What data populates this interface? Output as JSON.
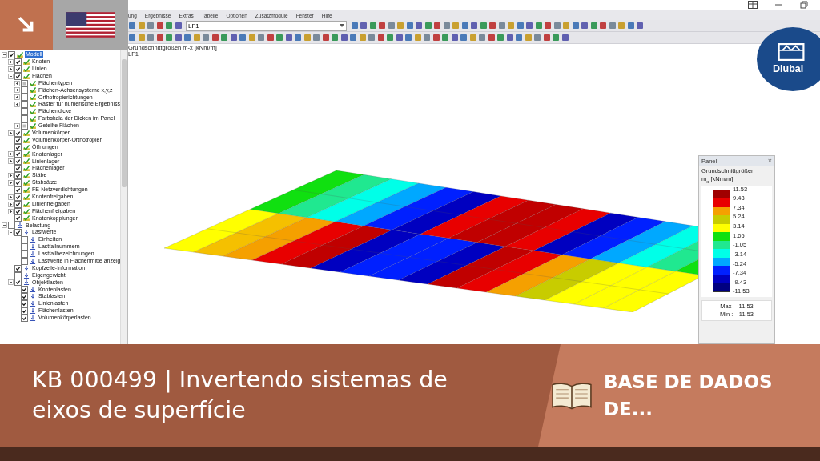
{
  "menu": [
    "ung",
    "Ergebnisse",
    "Extras",
    "Tabelle",
    "Optionen",
    "Zusatzmodule",
    "Fenster",
    "Hilfe"
  ],
  "toolbar": {
    "load_case": "LF1"
  },
  "tree": [
    {
      "label": "Modell",
      "checked": true,
      "kind": "model",
      "expanded": true,
      "selected": true,
      "children": [
        {
          "label": "Knoten",
          "checked": true,
          "kind": "model",
          "expanded": false,
          "selected": false
        },
        {
          "label": "Linien",
          "checked": true,
          "kind": "model",
          "expanded": false,
          "selected": false
        },
        {
          "label": "Flächen",
          "checked": true,
          "kind": "model",
          "expanded": true,
          "selected": false,
          "children": [
            {
              "label": "Flächentypen",
              "checked": false,
              "partial": true,
              "kind": "model",
              "expanded": false,
              "selected": false
            },
            {
              "label": "Flächen-Achsensysteme x,y,z",
              "checked": false,
              "kind": "model",
              "expanded": false,
              "selected": false
            },
            {
              "label": "Orthotropierichtungen",
              "checked": false,
              "kind": "model",
              "expanded": false,
              "selected": false
            },
            {
              "label": "Raster für numerische Ergebniss",
              "checked": false,
              "kind": "model",
              "expanded": false,
              "selected": false
            },
            {
              "label": "Flächendicke",
              "checked": false,
              "kind": "model",
              "selected": false
            },
            {
              "label": "Farbskala der Dicken im Panel",
              "checked": false,
              "kind": "model",
              "selected": false
            },
            {
              "label": "Geteilte Flächen",
              "checked": false,
              "partial": true,
              "kind": "model",
              "expanded": false,
              "selected": false
            }
          ]
        },
        {
          "label": "Volumenkörper",
          "checked": true,
          "kind": "model",
          "expanded": false,
          "selected": false
        },
        {
          "label": "Volumenkörper-Orthotropien",
          "checked": true,
          "kind": "model",
          "selected": false
        },
        {
          "label": "Öffnungen",
          "checked": true,
          "kind": "model",
          "selected": false
        },
        {
          "label": "Knotenlager",
          "checked": true,
          "kind": "model",
          "expanded": false,
          "selected": false
        },
        {
          "label": "Linienlager",
          "checked": true,
          "kind": "model",
          "expanded": false,
          "selected": false
        },
        {
          "label": "Flächenlager",
          "checked": true,
          "kind": "model",
          "selected": false
        },
        {
          "label": "Stäbe",
          "checked": true,
          "kind": "model",
          "expanded": false,
          "selected": false
        },
        {
          "label": "Stabsätze",
          "checked": true,
          "kind": "model",
          "expanded": false,
          "selected": false
        },
        {
          "label": "FE-Netzverdichtungen",
          "checked": true,
          "kind": "model",
          "selected": false
        },
        {
          "label": "Knotenfreigaben",
          "checked": true,
          "kind": "model",
          "expanded": false,
          "selected": false
        },
        {
          "label": "Linienfreigaben",
          "checked": true,
          "kind": "model",
          "expanded": false,
          "selected": false
        },
        {
          "label": "Flächenfreigaben",
          "checked": true,
          "kind": "model",
          "expanded": false,
          "selected": false
        },
        {
          "label": "Knotenkopplungen",
          "checked": true,
          "kind": "model",
          "selected": false
        }
      ]
    },
    {
      "label": "Belastung",
      "checked": false,
      "kind": "load",
      "expanded": true,
      "selected": false,
      "children": [
        {
          "label": "Lastwerte",
          "checked": true,
          "kind": "load",
          "expanded": true,
          "selected": false,
          "children": [
            {
              "label": "Einheiten",
              "checked": false,
              "kind": "load",
              "selected": false
            },
            {
              "label": "Lastfallnummern",
              "checked": false,
              "kind": "load",
              "selected": false
            },
            {
              "label": "Lastfallbezeichnungen",
              "checked": false,
              "kind": "load",
              "selected": false
            },
            {
              "label": "Lastwerte in Flächenmitte anzeig",
              "checked": false,
              "kind": "load",
              "selected": false
            }
          ]
        },
        {
          "label": "Kopfzeile-Information",
          "checked": true,
          "kind": "load",
          "selected": false
        },
        {
          "label": "Eigengewicht",
          "checked": false,
          "kind": "load",
          "selected": false
        },
        {
          "label": "Objektlasten",
          "checked": true,
          "kind": "load",
          "expanded": true,
          "selected": false,
          "children": [
            {
              "label": "Knotenlasten",
              "checked": true,
              "kind": "load",
              "selected": false
            },
            {
              "label": "Stablasten",
              "checked": true,
              "kind": "load",
              "selected": false
            },
            {
              "label": "Linienlasten",
              "checked": true,
              "kind": "load",
              "selected": false
            },
            {
              "label": "Flächenlasten",
              "checked": true,
              "kind": "load",
              "selected": false
            },
            {
              "label": "Volumenkörperlasten",
              "checked": true,
              "kind": "load",
              "selected": false
            }
          ]
        }
      ]
    }
  ],
  "viewport": {
    "result_label": "Grundschnittgrößen m-x [kNm/m]",
    "load_case": "LF1"
  },
  "panel": {
    "title": "Panel",
    "close": "×",
    "heading": "Grundschnittgrößen",
    "unit": "m$_{x}$ [kNm/m]",
    "bands": [
      {
        "color": "#a00000"
      },
      {
        "color": "#e80000"
      },
      {
        "color": "#f5a000"
      },
      {
        "color": "#c8cc00"
      },
      {
        "color": "#ffff00"
      },
      {
        "color": "#10e010"
      },
      {
        "color": "#20e890"
      },
      {
        "color": "#00ffe8"
      },
      {
        "color": "#00a8ff"
      },
      {
        "color": "#0020ff"
      },
      {
        "color": "#0000c0"
      },
      {
        "color": "#000080"
      }
    ],
    "ticks": [
      "11.53",
      "9.43",
      "7.34",
      "5.24",
      "3.14",
      "1.05",
      "-1.05",
      "-3.14",
      "-5.24",
      "-7.34",
      "-9.43",
      "-11.53"
    ],
    "max_label": "Max :",
    "max": "11.53",
    "min_label": "Min :",
    "min": "-11.53"
  },
  "logo": {
    "text": "Dlubal"
  },
  "banner": {
    "title": "KB 000499 | Invertendo sistemas de eixos de superfície",
    "category": "BASE DE DADOS DE..."
  }
}
